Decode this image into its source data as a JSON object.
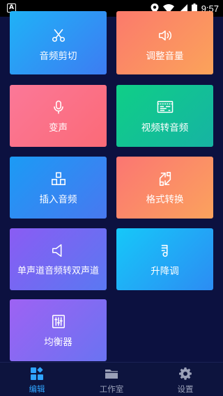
{
  "status_bar": {
    "left_badge": "A",
    "time": "9:57",
    "icons": [
      "notification-a-icon",
      "location-pin-icon",
      "wifi-icon",
      "signal-icon",
      "battery-icon"
    ]
  },
  "cards": [
    {
      "label": "音频剪切",
      "icon": "scissors-icon",
      "color": "#1fb2f7"
    },
    {
      "label": "调整音量",
      "icon": "speaker-icon",
      "color": "#fb7a6c"
    },
    {
      "label": "变声",
      "icon": "microphone-icon",
      "color": "#fb7898"
    },
    {
      "label": "视频转音频",
      "icon": "video-audio-icon",
      "color": "#0fcf87"
    },
    {
      "label": "插入音频",
      "icon": "insert-blocks-icon",
      "color": "#1b9bf5"
    },
    {
      "label": "格式转换",
      "icon": "convert-icon",
      "color": "#fb7672"
    },
    {
      "label": "单声道音频转双声道",
      "icon": "mono-speaker-icon",
      "color": "#8a5cf3"
    },
    {
      "label": "升降调",
      "icon": "pitch-note-icon",
      "color": "#16c8f9"
    },
    {
      "label": "均衡器",
      "icon": "equalizer-icon",
      "color": "#9e62f3"
    }
  ],
  "tabs": [
    {
      "label": "编辑",
      "icon": "edit-grid-icon",
      "active": true,
      "color": "#2fa4ff"
    },
    {
      "label": "工作室",
      "icon": "folder-icon",
      "active": false,
      "color": "#9aa0b8"
    },
    {
      "label": "设置",
      "icon": "gear-icon",
      "active": false,
      "color": "#9aa0b8"
    }
  ]
}
